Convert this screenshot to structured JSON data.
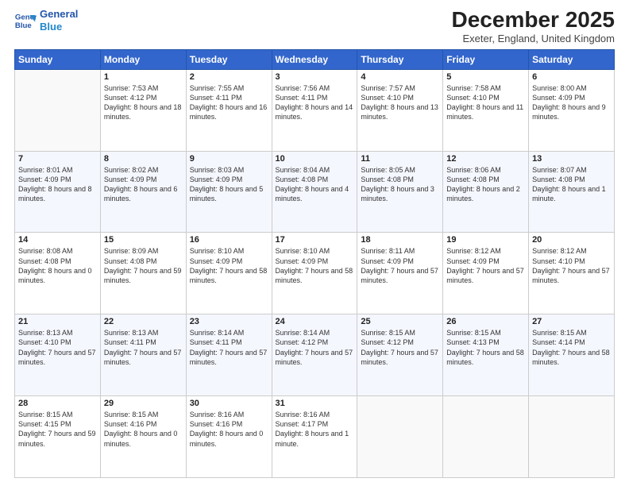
{
  "header": {
    "logo_line1": "General",
    "logo_line2": "Blue",
    "month": "December 2025",
    "location": "Exeter, England, United Kingdom"
  },
  "weekdays": [
    "Sunday",
    "Monday",
    "Tuesday",
    "Wednesday",
    "Thursday",
    "Friday",
    "Saturday"
  ],
  "weeks": [
    [
      {
        "day": "",
        "sunrise": "",
        "sunset": "",
        "daylight": ""
      },
      {
        "day": "1",
        "sunrise": "7:53 AM",
        "sunset": "4:12 PM",
        "daylight": "8 hours and 18 minutes."
      },
      {
        "day": "2",
        "sunrise": "7:55 AM",
        "sunset": "4:11 PM",
        "daylight": "8 hours and 16 minutes."
      },
      {
        "day": "3",
        "sunrise": "7:56 AM",
        "sunset": "4:11 PM",
        "daylight": "8 hours and 14 minutes."
      },
      {
        "day": "4",
        "sunrise": "7:57 AM",
        "sunset": "4:10 PM",
        "daylight": "8 hours and 13 minutes."
      },
      {
        "day": "5",
        "sunrise": "7:58 AM",
        "sunset": "4:10 PM",
        "daylight": "8 hours and 11 minutes."
      },
      {
        "day": "6",
        "sunrise": "8:00 AM",
        "sunset": "4:09 PM",
        "daylight": "8 hours and 9 minutes."
      }
    ],
    [
      {
        "day": "7",
        "sunrise": "8:01 AM",
        "sunset": "4:09 PM",
        "daylight": "8 hours and 8 minutes."
      },
      {
        "day": "8",
        "sunrise": "8:02 AM",
        "sunset": "4:09 PM",
        "daylight": "8 hours and 6 minutes."
      },
      {
        "day": "9",
        "sunrise": "8:03 AM",
        "sunset": "4:09 PM",
        "daylight": "8 hours and 5 minutes."
      },
      {
        "day": "10",
        "sunrise": "8:04 AM",
        "sunset": "4:08 PM",
        "daylight": "8 hours and 4 minutes."
      },
      {
        "day": "11",
        "sunrise": "8:05 AM",
        "sunset": "4:08 PM",
        "daylight": "8 hours and 3 minutes."
      },
      {
        "day": "12",
        "sunrise": "8:06 AM",
        "sunset": "4:08 PM",
        "daylight": "8 hours and 2 minutes."
      },
      {
        "day": "13",
        "sunrise": "8:07 AM",
        "sunset": "4:08 PM",
        "daylight": "8 hours and 1 minute."
      }
    ],
    [
      {
        "day": "14",
        "sunrise": "8:08 AM",
        "sunset": "4:08 PM",
        "daylight": "8 hours and 0 minutes."
      },
      {
        "day": "15",
        "sunrise": "8:09 AM",
        "sunset": "4:08 PM",
        "daylight": "7 hours and 59 minutes."
      },
      {
        "day": "16",
        "sunrise": "8:10 AM",
        "sunset": "4:09 PM",
        "daylight": "7 hours and 58 minutes."
      },
      {
        "day": "17",
        "sunrise": "8:10 AM",
        "sunset": "4:09 PM",
        "daylight": "7 hours and 58 minutes."
      },
      {
        "day": "18",
        "sunrise": "8:11 AM",
        "sunset": "4:09 PM",
        "daylight": "7 hours and 57 minutes."
      },
      {
        "day": "19",
        "sunrise": "8:12 AM",
        "sunset": "4:09 PM",
        "daylight": "7 hours and 57 minutes."
      },
      {
        "day": "20",
        "sunrise": "8:12 AM",
        "sunset": "4:10 PM",
        "daylight": "7 hours and 57 minutes."
      }
    ],
    [
      {
        "day": "21",
        "sunrise": "8:13 AM",
        "sunset": "4:10 PM",
        "daylight": "7 hours and 57 minutes."
      },
      {
        "day": "22",
        "sunrise": "8:13 AM",
        "sunset": "4:11 PM",
        "daylight": "7 hours and 57 minutes."
      },
      {
        "day": "23",
        "sunrise": "8:14 AM",
        "sunset": "4:11 PM",
        "daylight": "7 hours and 57 minutes."
      },
      {
        "day": "24",
        "sunrise": "8:14 AM",
        "sunset": "4:12 PM",
        "daylight": "7 hours and 57 minutes."
      },
      {
        "day": "25",
        "sunrise": "8:15 AM",
        "sunset": "4:12 PM",
        "daylight": "7 hours and 57 minutes."
      },
      {
        "day": "26",
        "sunrise": "8:15 AM",
        "sunset": "4:13 PM",
        "daylight": "7 hours and 58 minutes."
      },
      {
        "day": "27",
        "sunrise": "8:15 AM",
        "sunset": "4:14 PM",
        "daylight": "7 hours and 58 minutes."
      }
    ],
    [
      {
        "day": "28",
        "sunrise": "8:15 AM",
        "sunset": "4:15 PM",
        "daylight": "7 hours and 59 minutes."
      },
      {
        "day": "29",
        "sunrise": "8:15 AM",
        "sunset": "4:16 PM",
        "daylight": "8 hours and 0 minutes."
      },
      {
        "day": "30",
        "sunrise": "8:16 AM",
        "sunset": "4:16 PM",
        "daylight": "8 hours and 0 minutes."
      },
      {
        "day": "31",
        "sunrise": "8:16 AM",
        "sunset": "4:17 PM",
        "daylight": "8 hours and 1 minute."
      },
      {
        "day": "",
        "sunrise": "",
        "sunset": "",
        "daylight": ""
      },
      {
        "day": "",
        "sunrise": "",
        "sunset": "",
        "daylight": ""
      },
      {
        "day": "",
        "sunrise": "",
        "sunset": "",
        "daylight": ""
      }
    ]
  ]
}
